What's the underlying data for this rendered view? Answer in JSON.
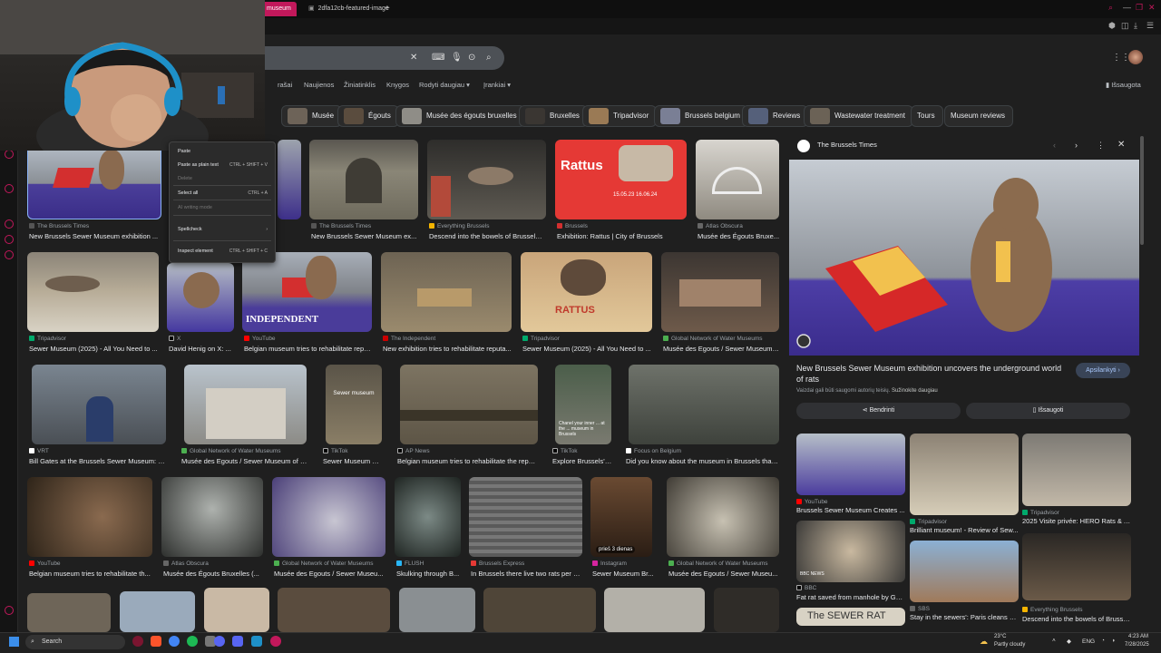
{
  "tabs": [
    {
      "label": "museum",
      "active": true
    },
    {
      "label": "2dfa12cb-featured-image",
      "active": false
    }
  ],
  "search": {
    "value": "",
    "placeholder": ""
  },
  "nav": {
    "items": [
      "rašai",
      "Naujienos",
      "Žiniatinklis",
      "Knygos",
      "Rodyti daugiau ▾",
      "Įrankiai ▾"
    ],
    "saved_label": "Išsaugota"
  },
  "chips": [
    "Musée",
    "Égouts",
    "Musée des égouts bruxelles",
    "Bruxelles",
    "Tripadvisor",
    "Brussels belgium",
    "Reviews",
    "Wastewater treatment",
    "Tours",
    "Museum reviews"
  ],
  "results": [
    {
      "source": "The Brussels Times",
      "title": "New Brussels Sewer Museum exhibition ..."
    },
    {
      "source": "The Brussels Times",
      "title": "New Brussels Sewer Museum ex..."
    },
    {
      "source": "Everything Brussels",
      "title": "Descend into the bowels of Brussels -..."
    },
    {
      "source": "Brussels",
      "title": "Exhibition: Rattus | City of Brussels"
    },
    {
      "source": "Atlas Obscura",
      "title": "Musée des Égouts Bruxe..."
    },
    {
      "source": "Tripadvisor",
      "title": "Sewer Museum (2025) - All You Need to ..."
    },
    {
      "source": "X",
      "title": "David Henig on X: ..."
    },
    {
      "source": "YouTube",
      "title": "Belgian museum tries to rehabilitate repu..."
    },
    {
      "source": "The Independent",
      "title": "New exhibition tries to rehabilitate reputa..."
    },
    {
      "source": "Tripadvisor",
      "title": "Sewer Museum (2025) - All You Need to ..."
    },
    {
      "source": "Global Network of Water Museums",
      "title": "Musée des Egouts / Sewer Museum ..."
    },
    {
      "source": "VRT",
      "title": "Bill Gates at the Brussels Sewer Museum: \"It ..."
    },
    {
      "source": "Global Network of Water Museums",
      "title": "Musée des Egouts / Sewer Museum of Br..."
    },
    {
      "source": "TikTok",
      "title": "Sewer Museum Ra..."
    },
    {
      "source": "AP News",
      "title": "Belgian museum tries to rehabilitate the reput..."
    },
    {
      "source": "TikTok",
      "title": "Explore Brussels' ..."
    },
    {
      "source": "Focus on Belgium",
      "title": "Did you know about the museum in Brussels that'..."
    },
    {
      "source": "YouTube",
      "title": "Belgian museum tries to rehabilitate th..."
    },
    {
      "source": "Atlas Obscura",
      "title": "Musée des Égouts Bruxelles (..."
    },
    {
      "source": "Global Network of Water Museums",
      "title": "Musée des Egouts / Sewer Museu..."
    },
    {
      "source": "FLUSH",
      "title": "Skulking through B..."
    },
    {
      "source": "Brussels Express",
      "title": "In Brussels there live two rats per p..."
    },
    {
      "source": "Instagram",
      "title": "Sewer Museum Br..."
    },
    {
      "source": "Global Network of Water Museums",
      "title": "Musée des Egouts / Sewer Museu..."
    }
  ],
  "overlays": {
    "rattus": "Rattus",
    "rattus_dates": "15.05.23 16.06.24",
    "independent": "INDEPENDENT",
    "sewer_museum": "Sewer museum",
    "sewer_caption": "Chanel your inner ... at the ... museum in Brussels",
    "time_ago": "prieš 3 dienas",
    "rattus_poster": "RATTUS"
  },
  "panel": {
    "source": "The Brussels Times",
    "title": "New Brussels Sewer Museum exhibition uncovers the underground world of rats",
    "visit_button": "Apsilankyti",
    "note": "Vaizdai gali būti saugomi autorių teisių.",
    "note_link": "Sužinokite daugiau",
    "share_button": "Bendrinti",
    "save_button": "Išsaugoti",
    "related": [
      {
        "source": "YouTube",
        "title": "Brussels Sewer Museum Creates ..."
      },
      {
        "source": "Tripadvisor",
        "title": "Brilliant museum! - Review of Sew..."
      },
      {
        "source": "Tripadvisor",
        "title": "2025 Visite privée: HERO Rats & A..."
      },
      {
        "source": "BBC",
        "title": "Fat rat saved from manhole by Ger..."
      },
      {
        "source": "SBS",
        "title": "Stay in the sewers': Paris cleans u..."
      },
      {
        "source": "Everything Brussels",
        "title": "Descend into the bowels of Brusse..."
      }
    ],
    "sewer_rat_text": "The SEWER RAT",
    "bbc_news": "BBC NEWS"
  },
  "context_menu": [
    {
      "label": "Paste",
      "shortcut": "",
      "dim": false
    },
    {
      "label": "Paste as plain text",
      "shortcut": "CTRL + SHIFT + V",
      "dim": false
    },
    {
      "label": "Delete",
      "shortcut": "",
      "dim": true
    },
    {
      "label": "Select all",
      "shortcut": "CTRL + A",
      "dim": false
    },
    {
      "label": "AI writing mode",
      "shortcut": "",
      "dim": true
    },
    {
      "label": "Spellcheck",
      "shortcut": "",
      "dim": false
    },
    {
      "label": "Inspect element",
      "shortcut": "CTRL + SHIFT + C",
      "dim": false
    }
  ],
  "taskbar": {
    "search": "Search",
    "weather_temp": "23°C",
    "weather_desc": "Partly cloudy",
    "lang": "ENG",
    "time": "4:23 AM",
    "date": "7/28/2025"
  }
}
